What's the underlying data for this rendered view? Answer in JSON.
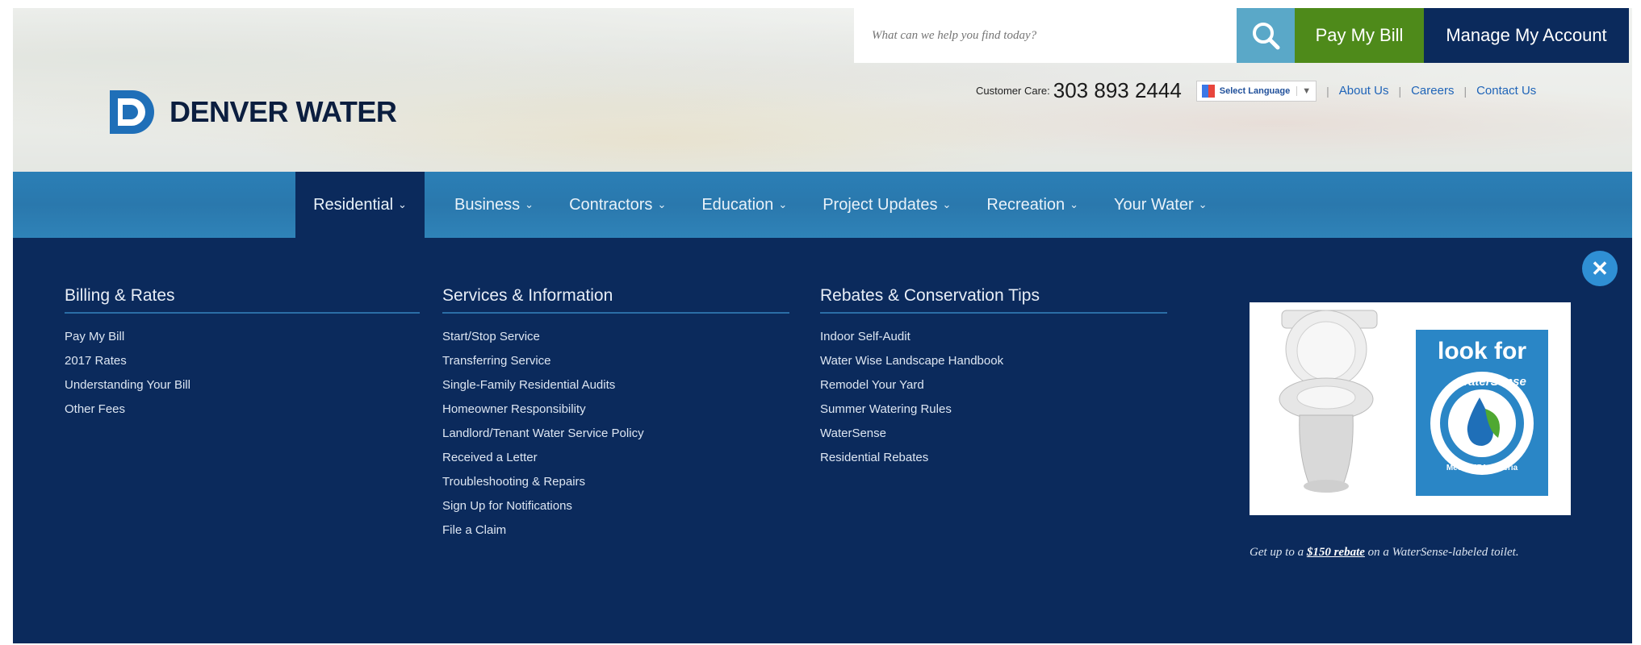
{
  "brand": {
    "name": "DENVER WATER"
  },
  "search": {
    "placeholder": "What can we help you find today?"
  },
  "top_actions": {
    "pay_bill": "Pay My Bill",
    "manage_account": "Manage My Account"
  },
  "utility": {
    "customer_care_label": "Customer Care:",
    "customer_care_number": "303 893 2444",
    "language": "Select Language",
    "links": [
      "About Us",
      "Careers",
      "Contact Us"
    ]
  },
  "nav": {
    "items": [
      {
        "label": "Residential"
      },
      {
        "label": "Business"
      },
      {
        "label": "Contractors"
      },
      {
        "label": "Education"
      },
      {
        "label": "Project Updates"
      },
      {
        "label": "Recreation"
      },
      {
        "label": "Your Water"
      }
    ]
  },
  "mega": {
    "columns": [
      {
        "title": "Billing & Rates",
        "items": [
          "Pay My Bill",
          "2017 Rates",
          "Understanding Your Bill",
          "Other Fees"
        ]
      },
      {
        "title": "Services & Information",
        "items": [
          "Start/Stop Service",
          "Transferring Service",
          "Single-Family Residential Audits",
          "Homeowner Responsibility",
          "Landlord/Tenant Water Service Policy",
          "Received a Letter",
          "Troubleshooting & Repairs",
          "Sign Up for Notifications",
          "File a Claim"
        ]
      },
      {
        "title": "Rebates & Conservation Tips",
        "items": [
          "Indoor Self-Audit",
          "Water Wise Landscape Handbook",
          "Remodel Your Yard",
          "Summer Watering Rules",
          "WaterSense",
          "Residential Rebates"
        ]
      }
    ],
    "promo": {
      "badge_top": "look for",
      "badge_ring": "WaterSense",
      "badge_bottom": "Meets EPA Criteria",
      "caption_pre": "Get up to a ",
      "caption_link": "$150 rebate",
      "caption_post": " on a WaterSense-labeled toilet."
    }
  },
  "colors": {
    "navy": "#0b2a5c",
    "nav_blue": "#2b7fb6",
    "green": "#4e8a1a",
    "search_blue": "#5aa8c8"
  }
}
